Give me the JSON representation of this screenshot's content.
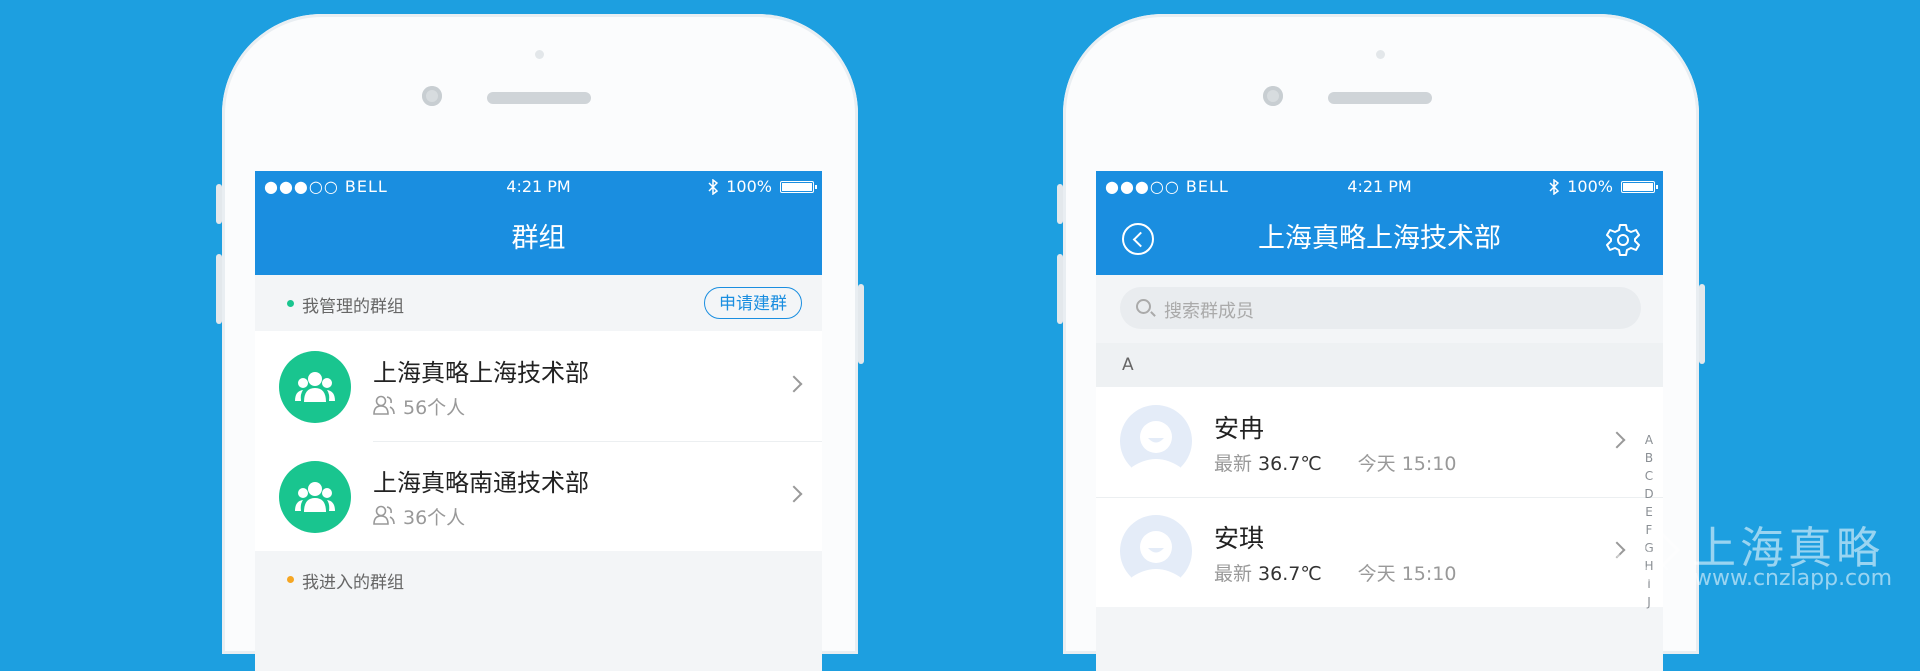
{
  "left_phone": {
    "status": {
      "carrier": "●●●○○ BELL",
      "time": "4:21 PM",
      "battery": "100%"
    },
    "title": "群组",
    "managed_section": {
      "label": "我管理的群组",
      "dot_color": "#19c58f",
      "action": "申请建群"
    },
    "groups": [
      {
        "name": "上海真略上海技术部",
        "count": "56个人"
      },
      {
        "name": "上海真略南通技术部",
        "count": "36个人"
      }
    ],
    "joined_section": {
      "label": "我进入的群组",
      "dot_color": "#f5a623"
    }
  },
  "right_phone": {
    "status": {
      "carrier": "●●●○○ BELL",
      "time": "4:21 PM",
      "battery": "100%"
    },
    "title": "上海真略上海技术部",
    "search_placeholder": "搜索群成员",
    "letter_header": "A",
    "members": [
      {
        "name": "安冉",
        "latest_label": "最新",
        "temperature": "36.7℃",
        "time": "今天 15:10"
      },
      {
        "name": "安琪",
        "latest_label": "最新",
        "temperature": "36.7℃",
        "time": "今天 15:10"
      }
    ],
    "index_letters": [
      "A",
      "B",
      "C",
      "D",
      "E",
      "F",
      "G",
      "H",
      "I",
      "J"
    ]
  },
  "watermark": {
    "title": "上海真略",
    "url": "www.cnzlapp.com"
  },
  "colors": {
    "background": "#1d9fe0",
    "primary": "#1a8ee0",
    "group_avatar": "#19c58f"
  }
}
